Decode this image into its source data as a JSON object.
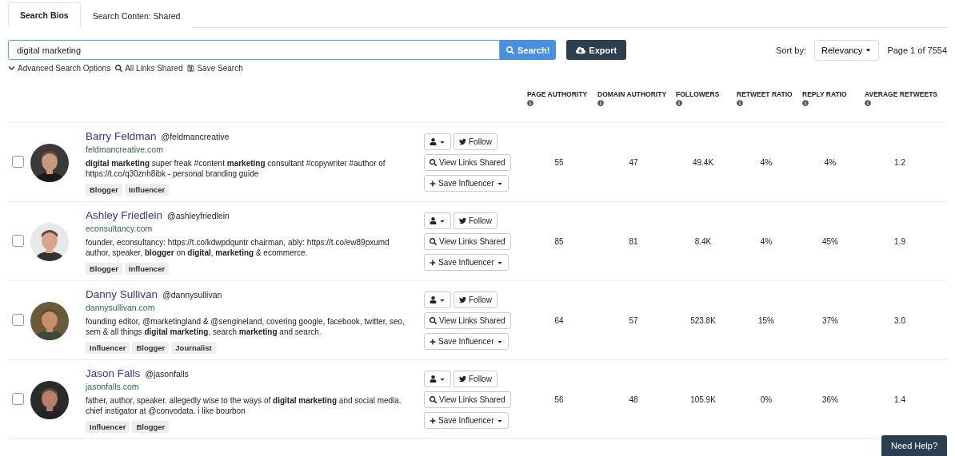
{
  "tabs": [
    {
      "label": "Search Bios",
      "selected": true
    },
    {
      "label": "Search Conten: Shared",
      "selected": false
    }
  ],
  "search": {
    "value": "digital marketing",
    "button": "Search!"
  },
  "export_button": "Export",
  "sort": {
    "label": "Sort by:",
    "value": "Relevancy"
  },
  "pagination": "Page 1 of 7554",
  "search_links": [
    "Advanced Search Options",
    "All Links Shared",
    "Save Search"
  ],
  "columns": [
    "PAGE AUTHORITY",
    "DOMAIN AUTHORITY",
    "FOLLOWERS",
    "RETWEET RATIO",
    "REPLY RATIO",
    "AVERAGE RETWEETS"
  ],
  "rows": [
    {
      "checked": false,
      "name": "Barry Feldman",
      "handle": "@feldmancreative",
      "site": "feldmancreative.com",
      "bio": "**digital marketing** super freak #content **marketing** consultant #copywriter #author of https://t.co/q30znh8ibk - personal branding guide",
      "tags": [
        "Blogger",
        "Influencer"
      ],
      "buttons": {
        "follow": "Follow",
        "view_links": "View Links Shared",
        "save": "Save Influencer"
      },
      "metrics": [
        "55",
        "47",
        "49.4K",
        "4%",
        "4%",
        "1.2"
      ]
    },
    {
      "checked": false,
      "name": "Ashley Friedlein",
      "handle": "@ashleyfriedlein",
      "site": "econsultancy.com",
      "bio": "founder, econsultancy: https://t.co/kdwpdquntr chairman, ably: https://t.co/ew89pxumd author, speaker, **blogger** on **digital**, **marketing** & ecommerce.",
      "tags": [
        "Blogger",
        "Influencer"
      ],
      "buttons": {
        "follow": "Follow",
        "view_links": "View Links Shared",
        "save": "Save Influencer"
      },
      "metrics": [
        "85",
        "81",
        "8.4K",
        "4%",
        "45%",
        "1.9"
      ]
    },
    {
      "checked": false,
      "name": "Danny Sullivan",
      "handle": "@dannysullivan",
      "site": "dannysullivan.com",
      "bio": "founding editor, @marketingland & @sengineland, covering google, facebook, twitter, seo, sem & all things **digital marketing**, search **marketing** and search.",
      "tags": [
        "Influencer",
        "Blogger",
        "Journalist"
      ],
      "buttons": {
        "follow": "Follow",
        "view_links": "View Links Shared",
        "save": "Save Influencer"
      },
      "metrics": [
        "64",
        "57",
        "523.8K",
        "15%",
        "37%",
        "3.0"
      ]
    },
    {
      "checked": false,
      "name": "Jason Falls",
      "handle": "@jasonfalls",
      "site": "jasonfalls.com",
      "bio": "father, author, speaker. allegedly wise to the ways of **digital marketing** and social media. chief instigator at @convodata. i like bourbon",
      "tags": [
        "Influencer",
        "Blogger"
      ],
      "buttons": {
        "follow": "Follow",
        "view_links": "View Links Shared",
        "save": "Save Influencer"
      },
      "metrics": [
        "56",
        "48",
        "105.9K",
        "0%",
        "36%",
        "1.4"
      ]
    }
  ],
  "help_button": "Need Help?"
}
